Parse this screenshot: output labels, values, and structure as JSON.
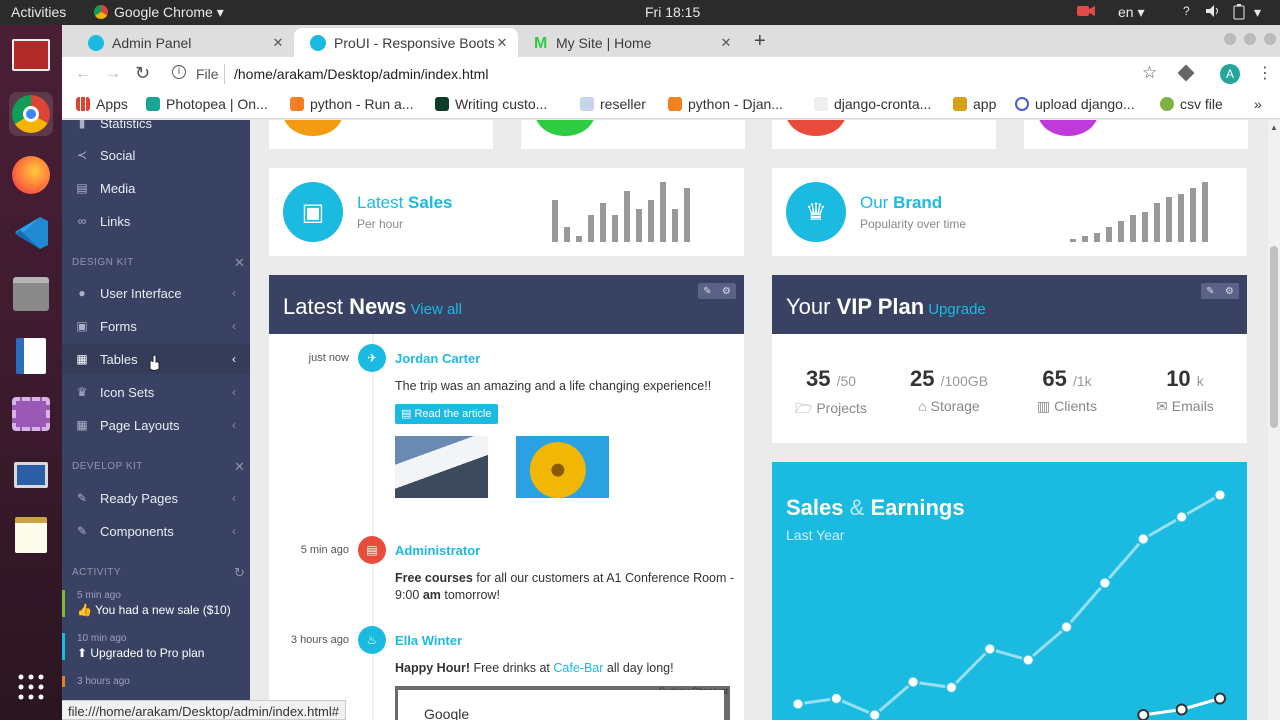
{
  "system": {
    "activities": "Activities",
    "app_name": "Google Chrome",
    "clock": "Fri 18:15",
    "lang": "en"
  },
  "browser": {
    "tabs": [
      {
        "title": "Admin Panel",
        "active": false
      },
      {
        "title": "ProUI - Responsive Bootstr",
        "active": true
      },
      {
        "title": "My Site | Home",
        "active": false
      }
    ],
    "address_scheme": "File",
    "address": "/home/arakam/Desktop/admin/index.html",
    "avatar_letter": "A",
    "bookmarks": [
      "Apps",
      "Photopea | On...",
      "python - Run a...",
      "Writing custo...",
      "reseller",
      "python - Djan...",
      "django-cronta...",
      "app",
      "upload django...",
      "csv file"
    ],
    "status_url": "file:///home/arakam/Desktop/admin/index.html#"
  },
  "sidebar": {
    "top_links": [
      "Statistics",
      "Social",
      "Media",
      "Links"
    ],
    "design_kit_heading": "DESIGN KIT",
    "design_kit": [
      "User Interface",
      "Forms",
      "Tables",
      "Icon Sets",
      "Page Layouts"
    ],
    "develop_kit_heading": "DEVELOP KIT",
    "develop_kit": [
      "Ready Pages",
      "Components"
    ],
    "activity_heading": "ACTIVITY",
    "activity": [
      {
        "time": "5 min ago",
        "text": "You had a new sale ($10)",
        "color": "#7db831"
      },
      {
        "time": "10 min ago",
        "text": "Upgraded to Pro plan",
        "color": "#1bbae1"
      },
      {
        "time": "3 hours ago",
        "text": "",
        "color": "#e67e22"
      }
    ]
  },
  "widgets": {
    "sales": {
      "title_light": "Latest",
      "title_bold": "Sales",
      "subtitle": "Per hour",
      "bars": [
        0.7,
        0.25,
        0.1,
        0.45,
        0.65,
        0.45,
        0.85,
        0.55,
        0.7,
        1.0,
        0.55,
        0.9
      ]
    },
    "brand": {
      "title_light": "Our",
      "title_bold": "Brand",
      "subtitle": "Popularity over time",
      "bars": [
        0.05,
        0.1,
        0.15,
        0.25,
        0.35,
        0.45,
        0.5,
        0.65,
        0.75,
        0.8,
        0.9,
        1.0
      ]
    }
  },
  "news": {
    "title_light": "Latest",
    "title_bold": "News",
    "link": "View all",
    "items": [
      {
        "time": "just now",
        "name": "Jordan Carter",
        "text": "The trip was an amazing and a life changing experience!!",
        "button": "Read the article",
        "color": "#1bbae1"
      },
      {
        "time": "5 min ago",
        "name": "Administrator",
        "text_bold": "Free courses",
        "text_rest": " for all our customers at A1 Conference Room - 9:00 ",
        "text_bold2": "am",
        "text_rest2": " tomorrow!",
        "color": "#e74c3c"
      },
      {
        "time": "3 hours ago",
        "name": "Ella Winter",
        "text_bold": "Happy Hour!",
        "text_rest": " Free drinks at ",
        "text_link": "Cafe-Bar",
        "text_rest2": " all day long!",
        "color": "#1bbae1"
      }
    ],
    "map_label": "Google",
    "map_caption": "Sydney Observat"
  },
  "vip": {
    "title_light": "Your",
    "title_bold": "VIP Plan",
    "link": "Upgrade",
    "stats": [
      {
        "value": "35",
        "unit": "/50",
        "label": "Projects"
      },
      {
        "value": "25",
        "unit": "/100GB",
        "label": "Storage"
      },
      {
        "value": "65",
        "unit": "/1k",
        "label": "Clients"
      },
      {
        "value": "10",
        "unit": "k",
        "label": "Emails"
      }
    ]
  },
  "earnings": {
    "title_bold": "Sales",
    "title_amp": "&",
    "title_bold2": "Earnings",
    "subtitle": "Last Year",
    "color": "#1bbae1"
  },
  "chart_data": {
    "type": "line",
    "title": "Sales & Earnings",
    "subtitle": "Last Year",
    "series": [
      {
        "values": [
          1,
          1.5,
          0,
          3,
          2.5,
          6,
          5,
          8,
          12,
          16,
          18,
          20
        ]
      },
      {
        "values": [
          0,
          0,
          0,
          0,
          0,
          0,
          0,
          0,
          0,
          0,
          0.5,
          1.5
        ]
      }
    ]
  }
}
